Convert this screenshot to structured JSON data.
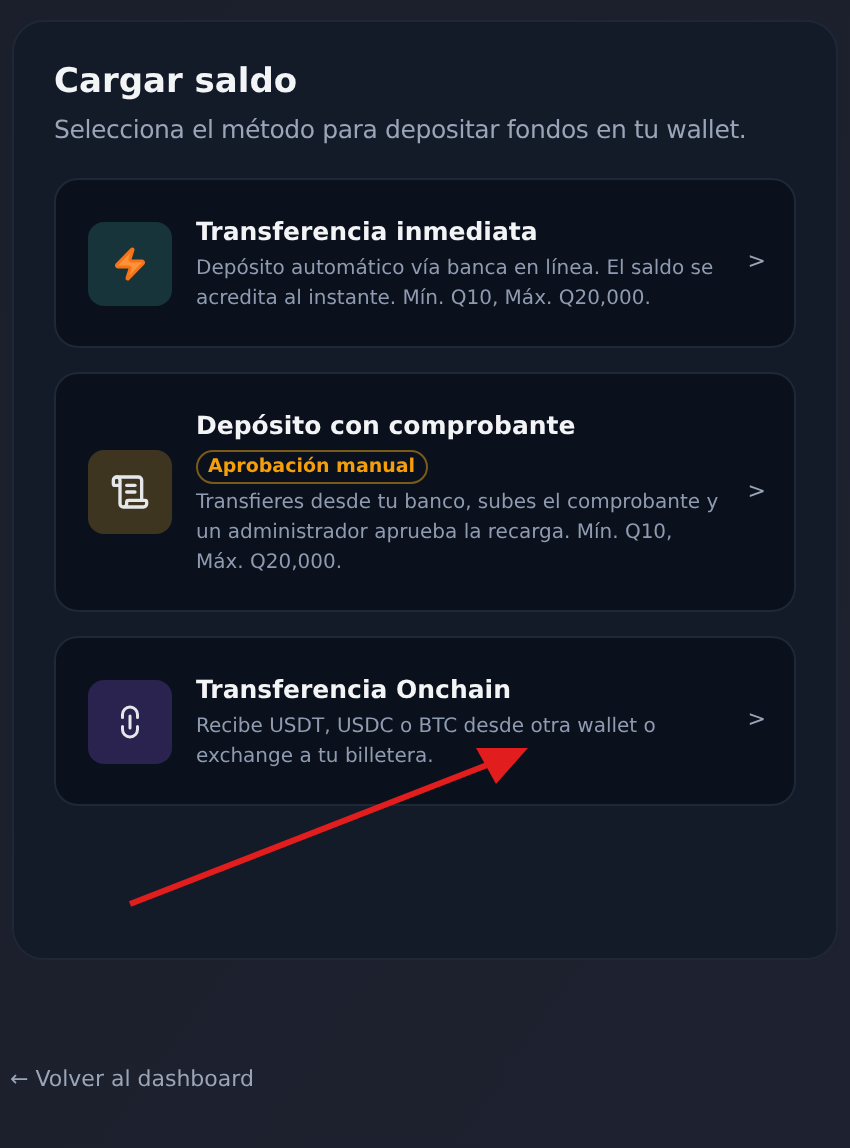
{
  "title": "Cargar saldo",
  "subtitle": "Selecciona el método para depositar fondos en tu wallet.",
  "methods": [
    {
      "kind": "instant",
      "title": "Transferencia inmediata",
      "description": "Depósito automático vía banca en línea. El saldo se acredita al instante. Mín. Q10, Máx. Q20,000.",
      "chevron": ">"
    },
    {
      "kind": "receipt",
      "title": "Depósito con comprobante",
      "badge": "Aprobación manual",
      "description": "Transfieres desde tu banco, subes el comprobante y un administrador aprueba la recarga. Mín. Q10, Máx. Q20,000.",
      "chevron": ">"
    },
    {
      "kind": "onchain",
      "title": "Transferencia Onchain",
      "description": "Recibe USDT, USDC o BTC desde otra wallet o exchange a tu billetera.",
      "chevron": ">"
    }
  ],
  "back_link": "← Volver al dashboard"
}
